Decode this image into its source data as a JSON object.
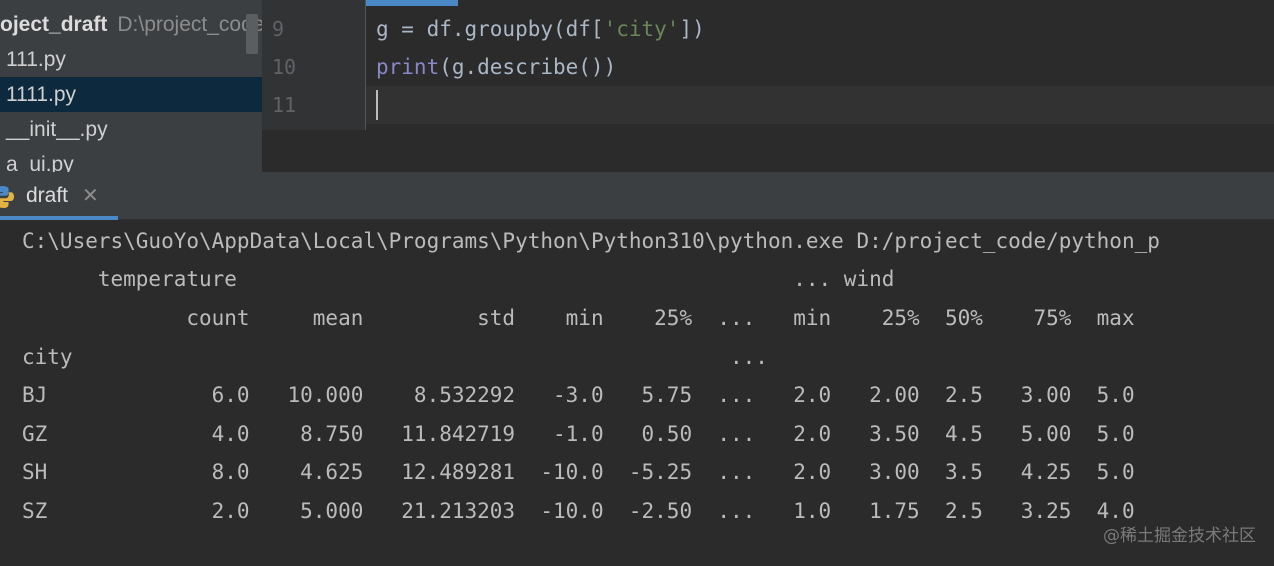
{
  "project_tree": {
    "project_name": "oject_draft",
    "project_path": "D:\\project_code",
    "items": [
      {
        "label": "111.py"
      },
      {
        "label": "1111.py"
      },
      {
        "label": "__init__.py"
      },
      {
        "label": "a_ui.py"
      }
    ]
  },
  "editor": {
    "lines": [
      {
        "number": "9",
        "tokens": [
          "g = df.groupby(df[",
          "'city'",
          "])"
        ]
      },
      {
        "number": "10",
        "tokens": [
          "print",
          "(g.describe())"
        ]
      },
      {
        "number": "11",
        "tokens": [
          ""
        ]
      }
    ]
  },
  "run_panel": {
    "tab_label": "draft",
    "close_glyph": "✕"
  },
  "console": {
    "lines": [
      "C:\\Users\\GuoYo\\AppData\\Local\\Programs\\Python\\Python310\\python.exe D:/project_code/python_p",
      "      temperature                                            ... wind",
      "             count     mean         std    min    25%  ...   min    25%  50%    75%  max",
      "city                                                    ...",
      "BJ             6.0   10.000    8.532292   -3.0   5.75  ...   2.0   2.00  2.5   3.00  5.0",
      "GZ             4.0    8.750   11.842719   -1.0   0.50  ...   2.0   3.50  4.5   5.00  5.0",
      "SH             8.0    4.625   12.489281  -10.0  -5.25  ...   2.0   3.00  3.5   4.25  5.0",
      "SZ             2.0    5.000   21.213203  -10.0  -2.50  ...   1.0   1.75  2.5   3.25  4.0"
    ]
  },
  "watermark": "@稀土掘金技术社区",
  "colors": {
    "accent": "#4a88c7",
    "selection": "#0d293e",
    "string": "#6a8759",
    "builtin": "#8888c6"
  }
}
